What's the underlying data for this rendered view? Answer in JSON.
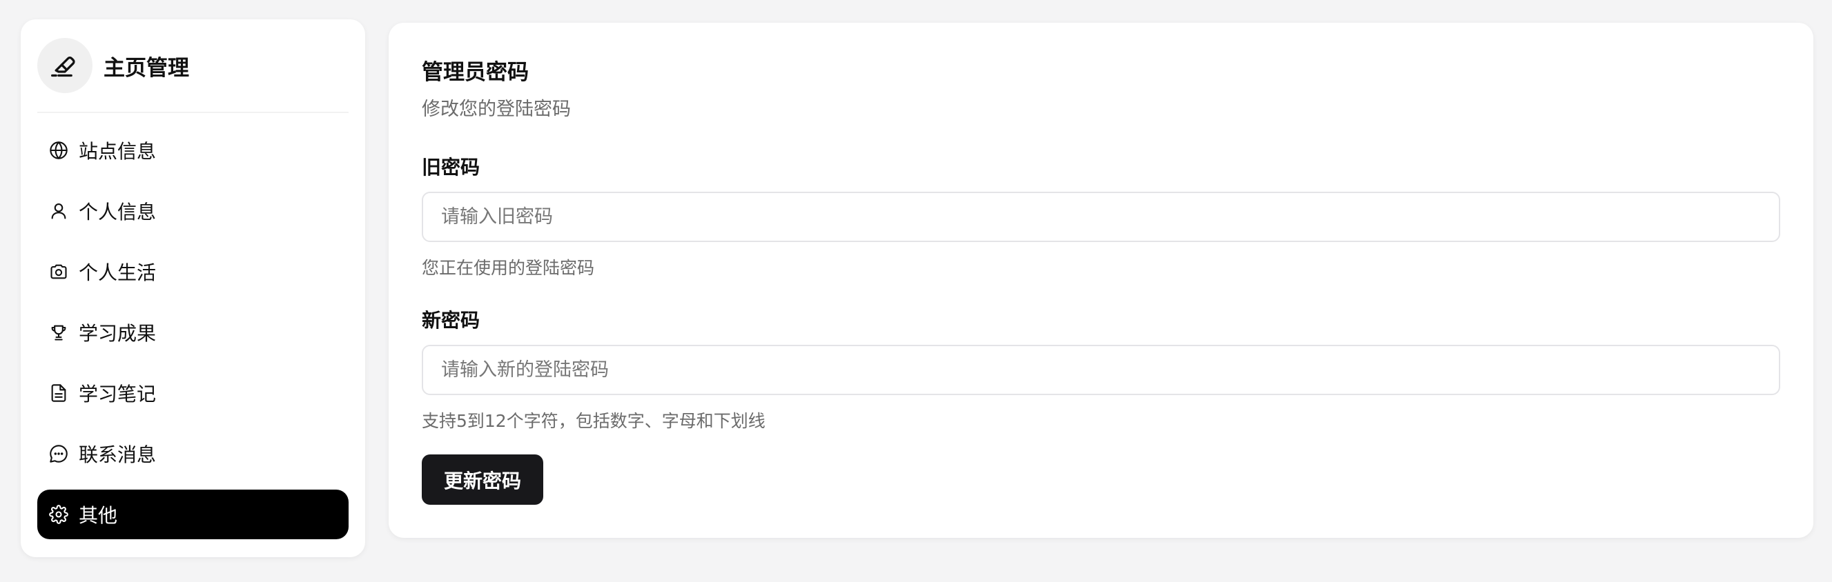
{
  "sidebar": {
    "brand_title": "主页管理",
    "items": [
      {
        "label": "站点信息",
        "icon": "globe-icon"
      },
      {
        "label": "个人信息",
        "icon": "user-icon"
      },
      {
        "label": "个人生活",
        "icon": "camera-icon"
      },
      {
        "label": "学习成果",
        "icon": "trophy-icon"
      },
      {
        "label": "学习笔记",
        "icon": "document-icon"
      },
      {
        "label": "联系消息",
        "icon": "chat-bubble-icon"
      },
      {
        "label": "其他",
        "icon": "gear-icon",
        "active": true
      }
    ]
  },
  "card": {
    "title": "管理员密码",
    "subtitle": "修改您的登陆密码",
    "old_password": {
      "label": "旧密码",
      "placeholder": "请输入旧密码",
      "value": "",
      "help": "您正在使用的登陆密码"
    },
    "new_password": {
      "label": "新密码",
      "placeholder": "请输入新的登陆密码",
      "value": "",
      "help": "支持5到12个字符，包括数字、字母和下划线"
    },
    "submit_label": "更新密码"
  },
  "colors": {
    "active_bg": "#000000",
    "button_bg": "#18181b",
    "page_bg": "#f4f4f5",
    "muted_text": "#6b6b6b"
  }
}
